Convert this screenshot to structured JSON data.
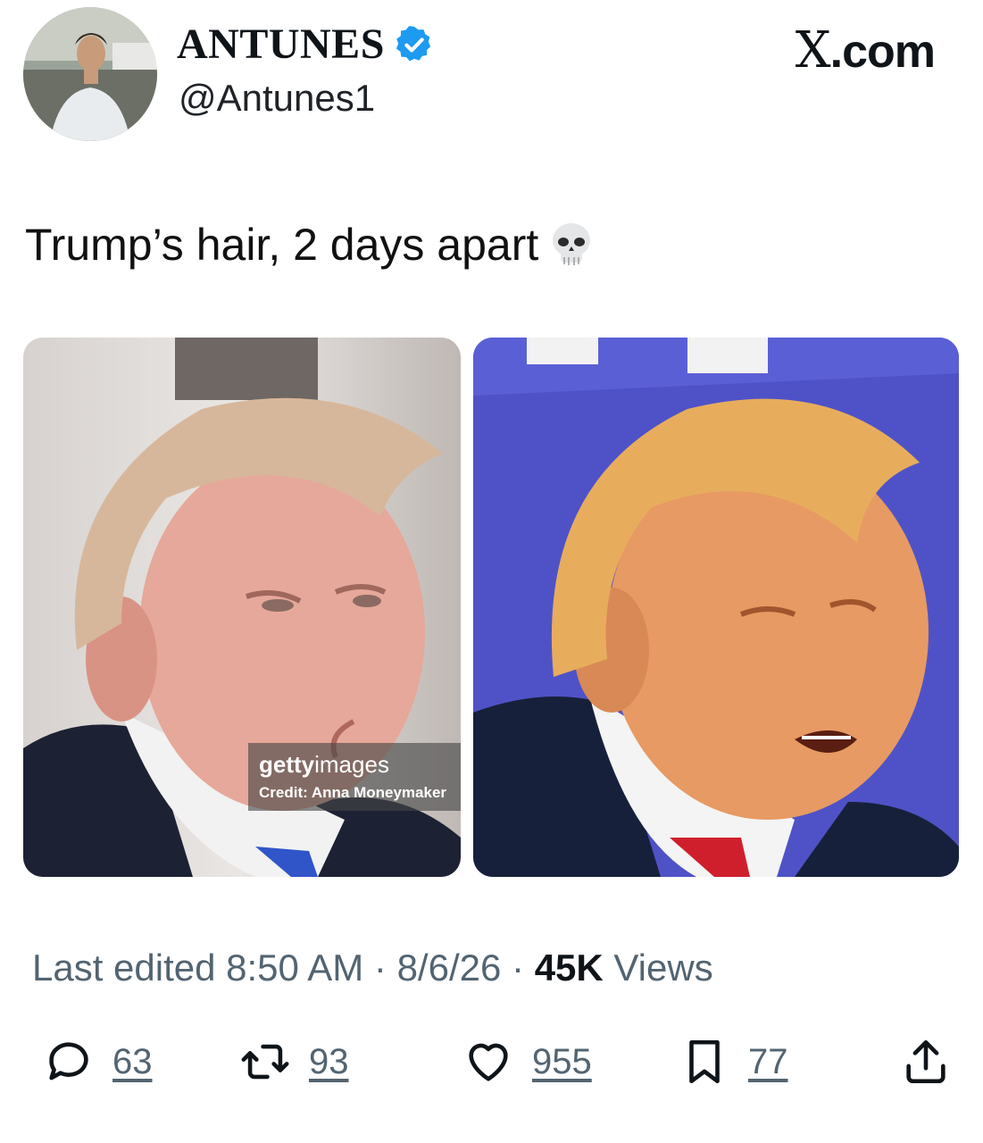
{
  "author": {
    "display_name": "ANTUNES",
    "handle": "@Antunes1",
    "verified_icon": "verified-badge-icon",
    "verified_color": "#1d9bf0"
  },
  "site_label": {
    "x": "X",
    "rest": ".com"
  },
  "tweet": {
    "text": "Trump’s hair, 2 days apart",
    "emoji": "skull"
  },
  "media": {
    "left_watermark_brand_bold": "getty",
    "left_watermark_brand_light": "images",
    "left_watermark_credit": "Credit: Anna Moneymaker"
  },
  "meta": {
    "edited": "Last edited 8:50 AM · 8/6/26",
    "separator": " · ",
    "views_count": "45K",
    "views_label": " Views"
  },
  "actions": {
    "replies": "63",
    "reposts": "93",
    "likes": "955",
    "bookmarks": "77"
  },
  "colors": {
    "text": "#0f1419",
    "muted": "#536471"
  }
}
